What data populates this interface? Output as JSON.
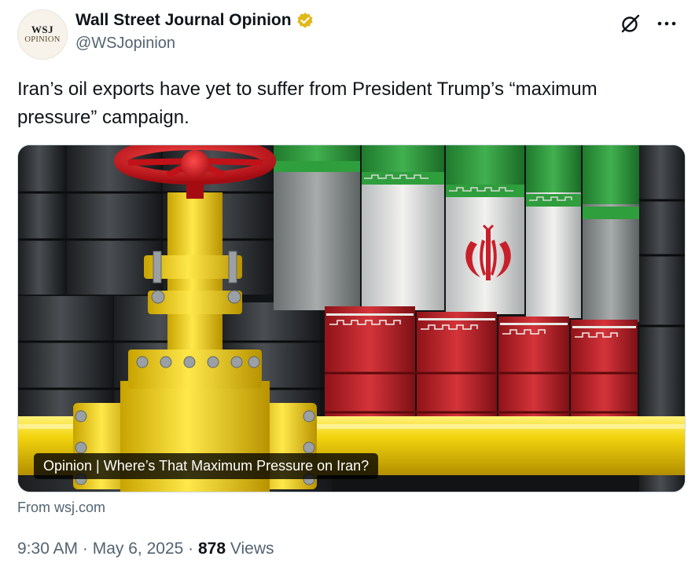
{
  "account": {
    "display_name": "Wall Street Journal Opinion",
    "handle": "@WSJopinion",
    "avatar_line1": "WSJ",
    "avatar_line2": "OPINION"
  },
  "tweet": {
    "text": "Iran’s oil exports have yet to suffer from President Trump’s “maximum pressure” campaign."
  },
  "card": {
    "caption": "Opinion | Where’s That Maximum Pressure on Iran?",
    "source": "From wsj.com"
  },
  "meta": {
    "time": "9:30 AM",
    "sep1": " · ",
    "date": "May 6, 2025",
    "sep2": " · ",
    "views_count": "878",
    "views_label": " Views"
  },
  "colors": {
    "verified_gold": "#e2b719",
    "iran_green": "#2f9e3c",
    "iran_red": "#c8202a",
    "pipe_yellow": "#f2d40e",
    "valve_red": "#d2141c"
  }
}
